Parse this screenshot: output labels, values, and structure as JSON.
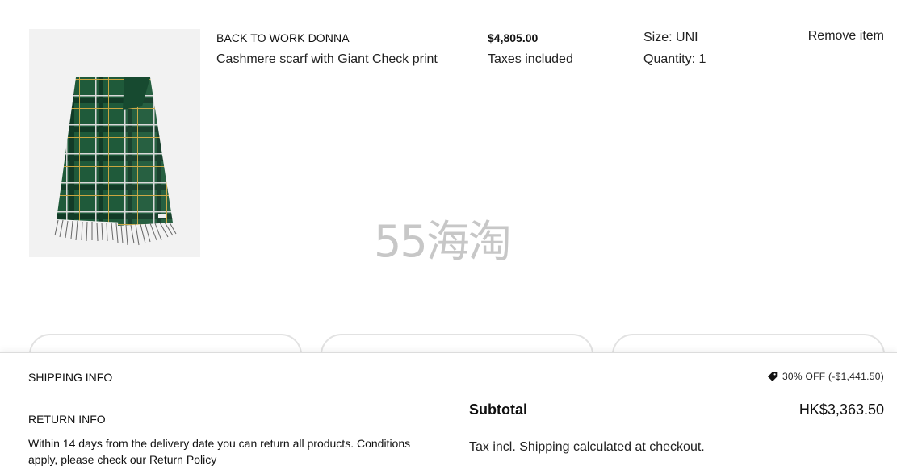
{
  "item": {
    "brand": "BACK TO WORK DONNA",
    "name": "Cashmere scarf with Giant Check print",
    "price": "$4,805.00",
    "taxes_note": "Taxes included",
    "size": "Size: UNI",
    "quantity": "Quantity: 1",
    "remove_label": "Remove item",
    "image_icon": "scarf-product-photo"
  },
  "watermark": "55海淘",
  "footer": {
    "shipping_label": "SHIPPING INFO",
    "returns_label": "RETURN INFO",
    "returns_text": "Within 14 days from the delivery date you can return all products. Conditions apply, please check our Return Policy",
    "discount_icon": "tag-icon",
    "discount_text": "30% OFF (-$1,441.50)",
    "subtotal_label": "Subtotal",
    "subtotal_value": "HK$3,363.50",
    "tax_shipping_note": "Tax incl. Shipping calculated at checkout."
  },
  "colors": {
    "scarf_green": "#1f5a3a",
    "check_yellow": "#c9a640",
    "background": "#ffffff"
  }
}
